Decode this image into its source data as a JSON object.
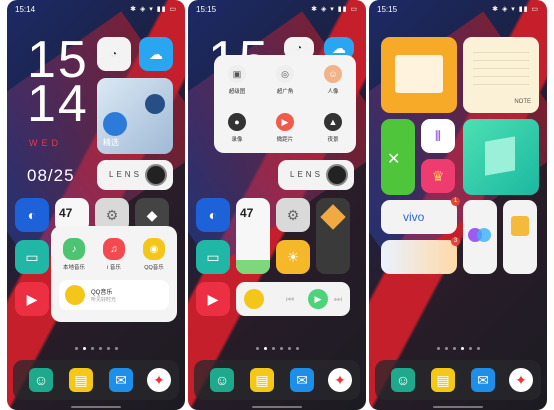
{
  "screens": [
    {
      "time": "15:14",
      "clock_hour": "15",
      "clock_minute": "14",
      "weekday": "WED",
      "date": "08/25",
      "weekday_num": "47",
      "weather_tile_label": "精选",
      "lens_label": "LENS",
      "music_apps": [
        "本地音乐",
        "i 音乐",
        "QQ音乐"
      ],
      "qq_music_title": "QQ音乐",
      "qq_music_sub": "听见好时光"
    },
    {
      "time": "15:15",
      "camera_modes": [
        "超级图",
        "超广角",
        "人像",
        "录像",
        "微距片",
        "夜景"
      ],
      "weekday_num": "47",
      "lens_label": "LENS"
    },
    {
      "time": "15:15",
      "note_label": "NOTE",
      "vivo_label": "vivo",
      "badge_count": "1",
      "badge_count_2": "3"
    }
  ],
  "dock_icons": [
    "contacts-icon",
    "files-icon",
    "mail-icon",
    "compass-icon"
  ],
  "status_icons": "✱ ◈ ▾ ▮▮ ▭"
}
